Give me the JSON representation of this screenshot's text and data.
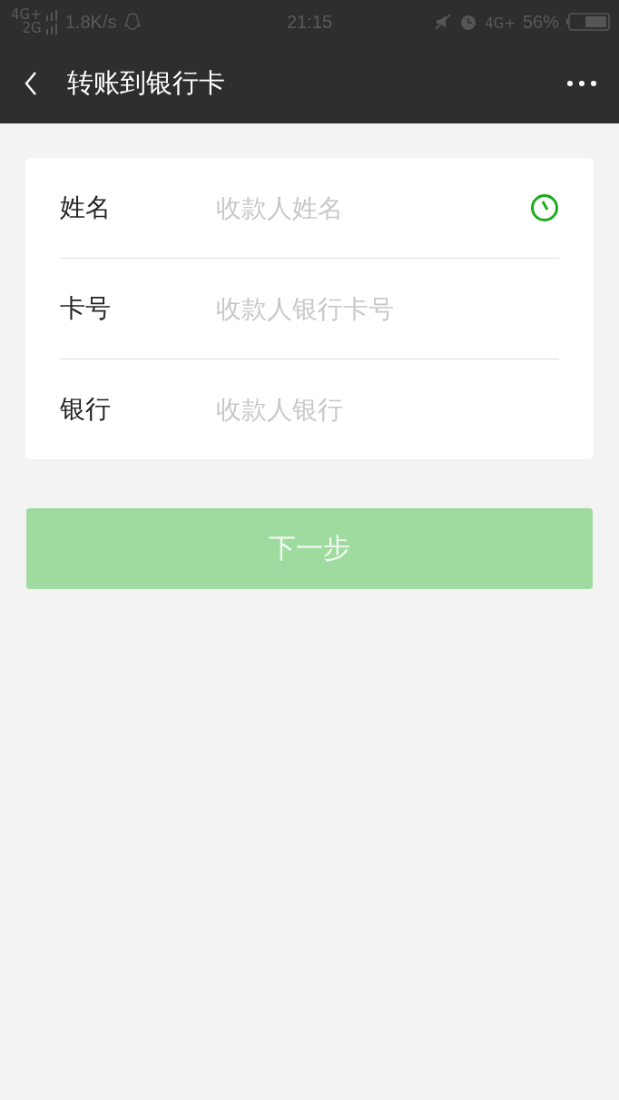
{
  "status_bar": {
    "network_top": "4G+",
    "network_bottom": "2G",
    "speed": "1.8K/s",
    "time": "21:15",
    "network_right": "4G+",
    "battery": "56%"
  },
  "nav_bar": {
    "title": "转账到银行卡"
  },
  "form": {
    "fields": [
      {
        "label": "姓名",
        "placeholder": "收款人姓名",
        "history_icon": true
      },
      {
        "label": "卡号",
        "placeholder": "收款人银行卡号",
        "history_icon": false
      },
      {
        "label": "银行",
        "placeholder": "收款人银行",
        "history_icon": false
      }
    ]
  },
  "next_button": {
    "label": "下一步",
    "disabled": true
  }
}
